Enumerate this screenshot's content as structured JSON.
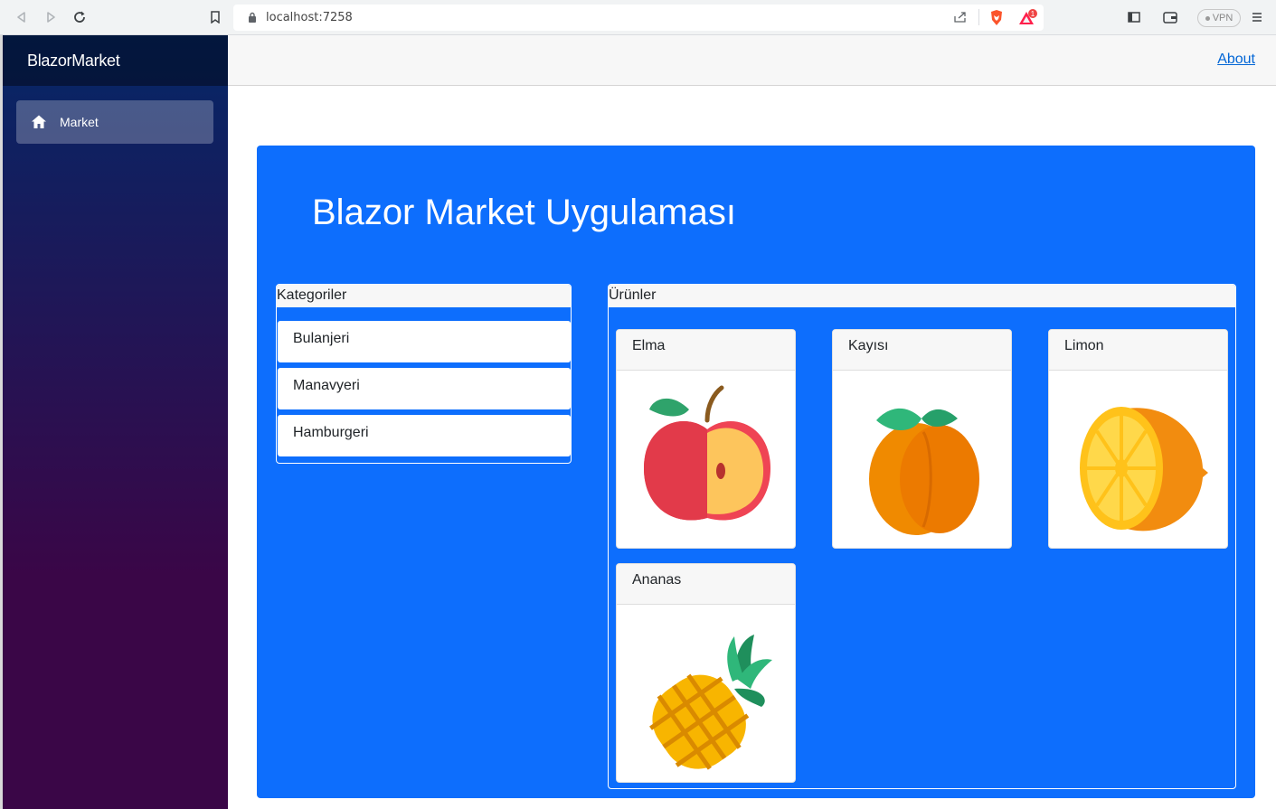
{
  "browser": {
    "url": "localhost:7258",
    "vpn_label": "VPN",
    "notification_count": "1"
  },
  "sidebar": {
    "brand": "BlazorMarket",
    "items": [
      {
        "label": "Market",
        "icon": "home-icon",
        "active": true
      }
    ]
  },
  "top_row": {
    "about_label": "About"
  },
  "main": {
    "title": "Blazor Market Uygulaması",
    "categories": {
      "header": "Kategoriler",
      "items": [
        "Bulanjeri",
        "Manavyeri",
        "Hamburgeri"
      ]
    },
    "products": {
      "header": "Ürünler",
      "items": [
        {
          "name": "Elma",
          "icon": "apple-icon"
        },
        {
          "name": "Kayısı",
          "icon": "apricot-icon"
        },
        {
          "name": "Limon",
          "icon": "lemon-icon"
        },
        {
          "name": "Ananas",
          "icon": "pineapple-icon"
        }
      ]
    }
  },
  "colors": {
    "accent": "#0d6efd",
    "sidebar_top": "#052767",
    "sidebar_bottom": "#3a0647",
    "link": "#0366d6"
  }
}
